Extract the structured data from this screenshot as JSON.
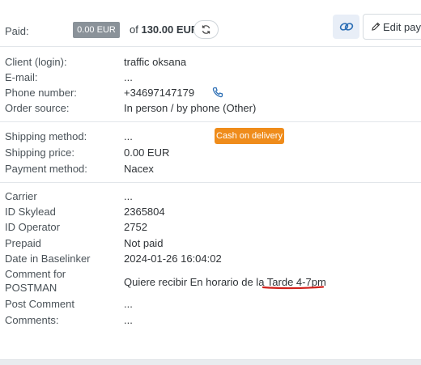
{
  "payment": {
    "paid_label": "Paid:",
    "paid_amount": "0.00 EUR",
    "of_prefix": "of",
    "total": "130.00 EUR"
  },
  "toolbar": {
    "edit_label": "Edit paym"
  },
  "client": {
    "login_label": "Client (login):",
    "login_value": "traffic oksana",
    "email_label": "E-mail:",
    "email_value": "...",
    "phone_label": "Phone number:",
    "phone_value": "+34697147179",
    "source_label": "Order source:",
    "source_value": "In person / by phone (Other)"
  },
  "shipping": {
    "method_label": "Shipping method:",
    "method_value": "...",
    "cod_badge": "Cash on delivery",
    "price_label": "Shipping price:",
    "price_value": "0.00 EUR",
    "payment_method_label": "Payment method:",
    "payment_method_value": "Nacex"
  },
  "details": {
    "carrier_label": "Carrier",
    "carrier_value": "...",
    "skylead_label": "ID Skylead",
    "skylead_value": "2365804",
    "operator_label": "ID Operator",
    "operator_value": "2752",
    "prepaid_label": "Prepaid",
    "prepaid_value": "Not paid",
    "baselinker_label": "Date in Baselinker",
    "baselinker_value": "2024-01-26 16:04:02",
    "comment_postman_label_1": "Comment for",
    "comment_postman_label_2": "POSTMAN",
    "comment_postman_value": "Quiere recibir En horario de la Tarde 4-7pm",
    "post_comment_label": "Post Comment",
    "post_comment_value": "...",
    "comments_label": "Comments:",
    "comments_value": "..."
  },
  "colors": {
    "grey_badge": "#8a9299",
    "cod_badge": "#ef8c1b",
    "link_blue": "#2d6fb5",
    "annotation_red": "#d0211c"
  },
  "icons": [
    "refresh-icon",
    "link-icon",
    "pencil-icon",
    "phone-icon"
  ]
}
